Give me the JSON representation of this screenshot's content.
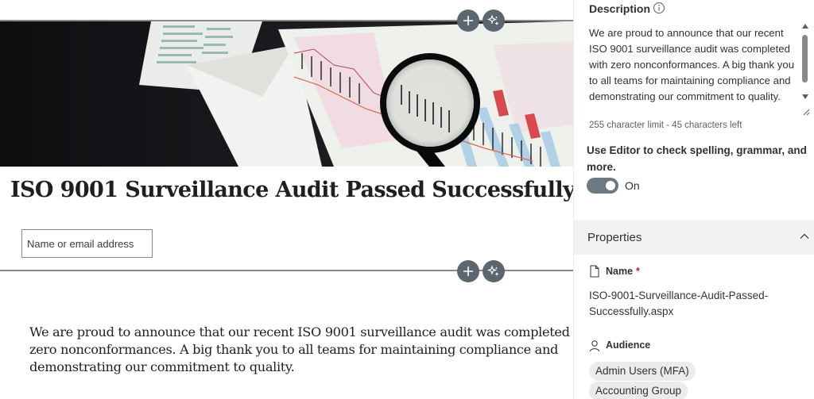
{
  "canvas": {
    "add_section_label": "+",
    "title": "ISO 9001 Surveillance Audit Passed Successfully",
    "author_placeholder": "Name or email address",
    "body_text": "We are proud to announce that our recent ISO 9001 surveillance audit was completed with zero nonconformances. A big thank you to all teams for maintaining compliance and demonstrating our commitment to quality."
  },
  "pane": {
    "description": {
      "label": "Description",
      "text": "We are proud to announce that our recent ISO 9001 surveillance audit was completed with zero nonconformances. A big thank you to all teams for maintaining compliance and demonstrating our commitment to quality.",
      "char_limit": "255 character limit - 45 characters left"
    },
    "editor": {
      "label": "Use Editor to check spelling, grammar, and more.",
      "toggle_state": "On",
      "toggle_on": true
    },
    "properties": {
      "title": "Properties",
      "name_label": "Name",
      "required_mark": "*",
      "name_value": "ISO-9001-Surveillance-Audit-Passed-Successfully.aspx",
      "audience_label": "Audience",
      "audiences": [
        "Admin Users (MFA)",
        "Accounting Group"
      ]
    }
  },
  "colors": {
    "accent_button": "#5b6670",
    "toggle_on": "#6e7880",
    "required": "#a4262c",
    "section_header_bg": "#f3f2f1"
  },
  "icons": [
    "add-icon",
    "design-ideas-icon",
    "info-icon",
    "document-icon",
    "audience-icon",
    "chevron-up-icon"
  ]
}
